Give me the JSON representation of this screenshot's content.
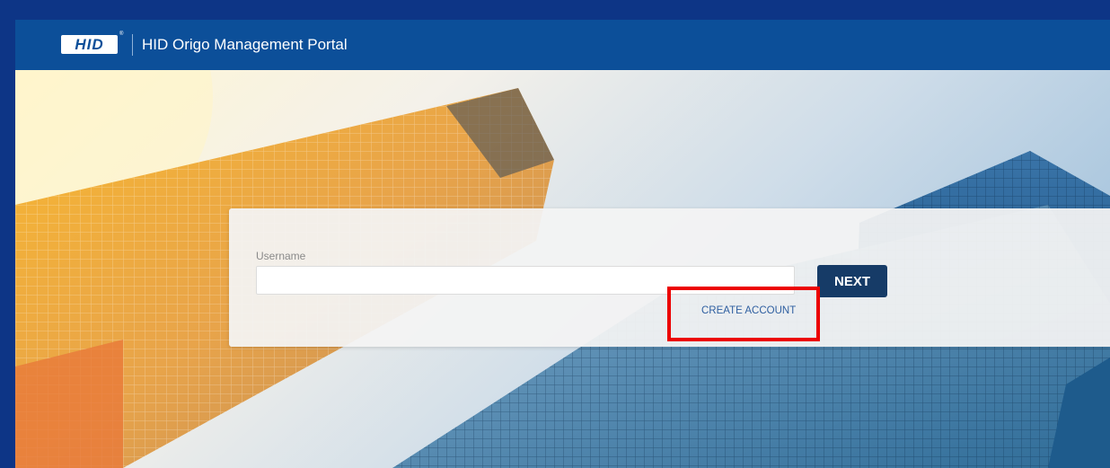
{
  "header": {
    "logo_text": "HID",
    "logo_mark": "®",
    "title": "HID Origo Management Portal"
  },
  "login": {
    "username_label": "Username",
    "username_value": "",
    "next_label": "NEXT",
    "create_account_label": "CREATE ACCOUNT"
  },
  "colors": {
    "frame": "#0d3586",
    "header": "#0c4f99",
    "button": "#163b67",
    "link": "#2f5fa0",
    "highlight": "#ec0000"
  }
}
